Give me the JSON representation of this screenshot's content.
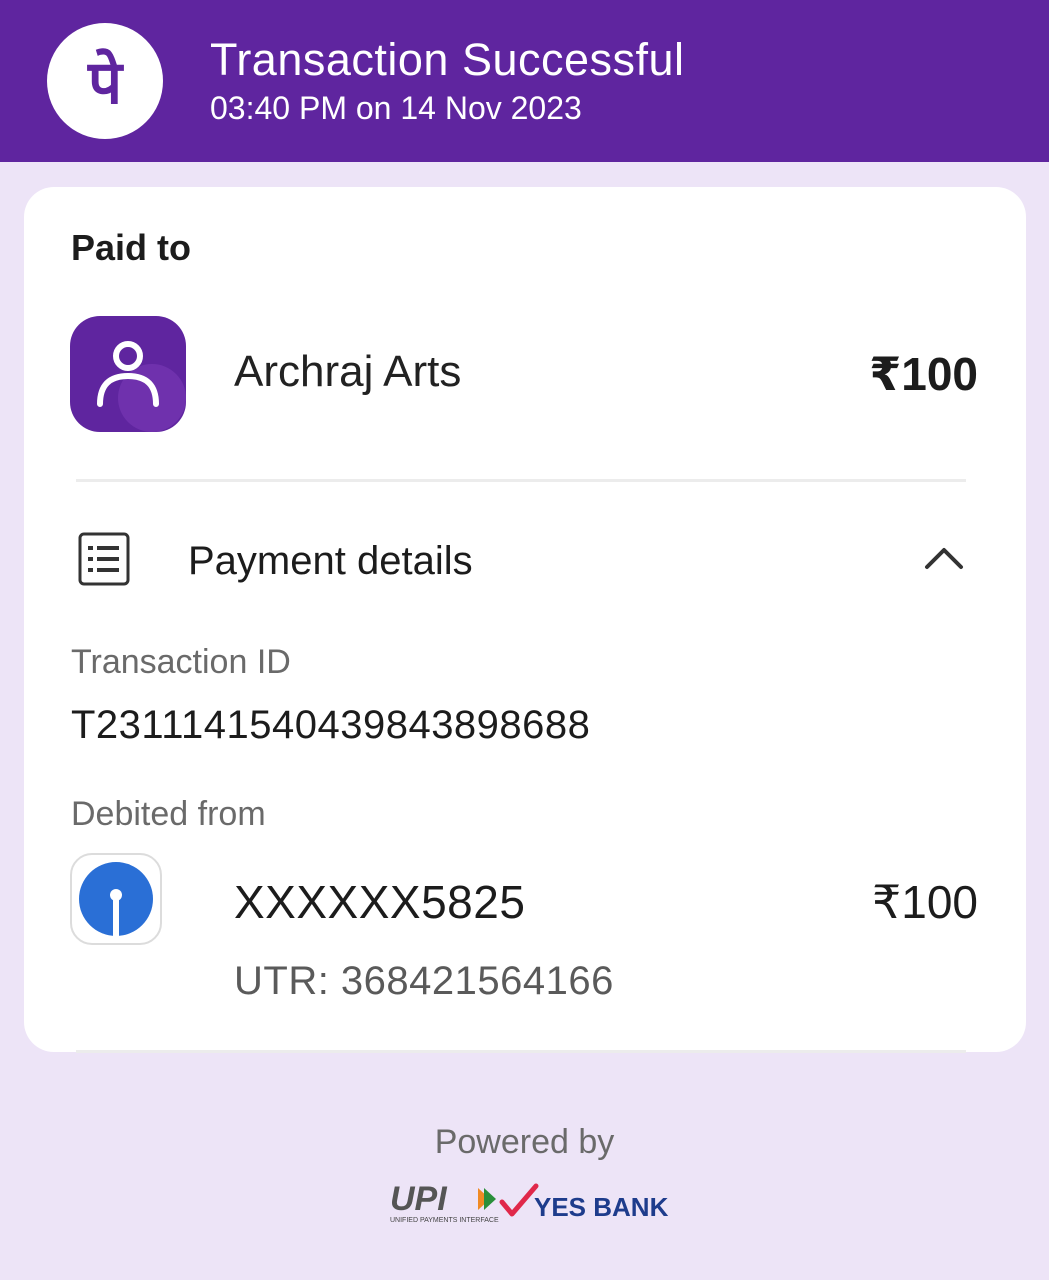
{
  "header": {
    "title": "Transaction Successful",
    "datetime": "03:40 PM on 14 Nov 2023",
    "logo_glyph": "पे",
    "background_color": "#5f259f"
  },
  "payee": {
    "section_label": "Paid to",
    "name": "Archraj Arts",
    "amount": "₹100",
    "avatar_icon": "person-icon"
  },
  "payment_details": {
    "label": "Payment details",
    "icon": "receipt-list-icon",
    "toggle_icon": "chevron-up-icon",
    "transaction_id_label": "Transaction ID",
    "transaction_id": "T2311141540439843898688",
    "debited_from_label": "Debited from",
    "account_number": "XXXXXX5825",
    "debited_amount": "₹100",
    "utr": "UTR: 368421564166",
    "bank_icon": "sbi-bank-icon"
  },
  "footer": {
    "powered_by": "Powered by",
    "upi_text": "UPI",
    "upi_subtext": "UNIFIED PAYMENTS INTERFACE",
    "bank_text": "YES BANK"
  }
}
